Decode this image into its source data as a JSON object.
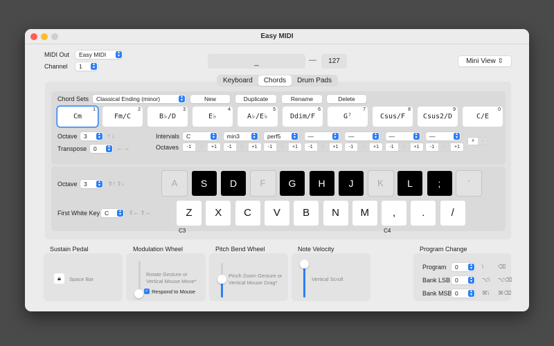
{
  "window": {
    "title": "Easy MIDI"
  },
  "header": {
    "midi_out_label": "MIDI Out",
    "midi_out_value": "Easy MIDI",
    "channel_label": "Channel",
    "channel_value": "1",
    "note_display": "_",
    "dash": "—",
    "velocity_display": "127",
    "mini_view_label": "Mini View",
    "mini_view_icon": "⇳"
  },
  "tabs": [
    {
      "label": "Keyboard",
      "selected": false
    },
    {
      "label": "Chords",
      "selected": true
    },
    {
      "label": "Drum Pads",
      "selected": false
    }
  ],
  "chords": {
    "chord_sets_label": "Chord Sets",
    "chord_set_value": "Classical Ending (minor)",
    "buttons": {
      "new": "New",
      "duplicate": "Duplicate",
      "rename": "Rename",
      "delete": "Delete"
    },
    "items": [
      {
        "name": "Cm",
        "key": "1",
        "selected": true
      },
      {
        "name": "Fm/C",
        "key": "2"
      },
      {
        "name": "B♭/D",
        "key": "3"
      },
      {
        "name": "E♭",
        "key": "4"
      },
      {
        "name": "A♭/E♭",
        "key": "5"
      },
      {
        "name": "Ddim/F",
        "key": "6"
      },
      {
        "name": "G⁷",
        "key": "7"
      },
      {
        "name": "Csus/F",
        "key": "8"
      },
      {
        "name": "Csus2/D",
        "key": "9"
      },
      {
        "name": "C/E",
        "key": "0"
      }
    ],
    "octave_label": "Octave",
    "octave_value": "3",
    "octave_arrows": "↑ ↓",
    "transpose_label": "Transpose",
    "transpose_value": "0",
    "transpose_arrows": "← →",
    "intervals_label": "Intervals",
    "octaves_label": "Octaves",
    "intervals": [
      "C",
      "min3",
      "perf5",
      "—",
      "—",
      "—",
      "—"
    ],
    "octave_buttons": {
      "minus": "-1",
      "zero": "0",
      "plus": "+1"
    },
    "sharp_flat": {
      "sharp": "#",
      "flat": "♭"
    }
  },
  "keyboard": {
    "octave_label": "Octave",
    "octave_value": "3",
    "octave_shortcuts": "⇧↑  ⇧↓",
    "first_white_key_label": "First White Key",
    "first_white_key_value": "C",
    "first_white_key_shortcuts": "⇧←  ⇧→",
    "black_row": [
      {
        "label": "A",
        "type": "dis"
      },
      {
        "label": "S",
        "type": "blk"
      },
      {
        "label": "D",
        "type": "blk"
      },
      {
        "label": "F",
        "type": "dis"
      },
      {
        "label": "G",
        "type": "blk"
      },
      {
        "label": "H",
        "type": "blk"
      },
      {
        "label": "J",
        "type": "blk"
      },
      {
        "label": "K",
        "type": "dis"
      },
      {
        "label": "L",
        "type": "blk"
      },
      {
        "label": ";",
        "type": "blk"
      },
      {
        "label": "'",
        "type": "dis"
      }
    ],
    "white_row": [
      {
        "label": "Z",
        "note": "C3"
      },
      {
        "label": "X",
        "note": ""
      },
      {
        "label": "C",
        "note": ""
      },
      {
        "label": "V",
        "note": ""
      },
      {
        "label": "B",
        "note": ""
      },
      {
        "label": "N",
        "note": ""
      },
      {
        "label": "M",
        "note": ""
      },
      {
        "label": ",",
        "note": "C4"
      },
      {
        "label": ".",
        "note": ""
      },
      {
        "label": "/",
        "note": ""
      }
    ]
  },
  "controls": {
    "sustain": {
      "title": "Sustain Pedal",
      "key_label": "Space Bar"
    },
    "modulation": {
      "title": "Modulation Wheel",
      "hint": "Rotate Gesture or Vertical Mouse Move*",
      "respond_label": "Respond to Mouse",
      "respond_checked": true,
      "value": 0
    },
    "pitch_bend": {
      "title": "Pitch Bend Wheel",
      "hint": "Pinch Zoom Gesture or Vertical Mouse Drag*",
      "value": 0.5
    },
    "velocity": {
      "title": "Note Velocity",
      "hint": "Vertical Scroll",
      "value": 1.0
    },
    "program_change": {
      "title": "Program Change",
      "rows": [
        {
          "label": "Program",
          "value": "0",
          "inc": "\\",
          "dec": "⌫"
        },
        {
          "label": "Bank LSB",
          "value": "0",
          "inc": "⌥\\",
          "dec": "⌥⌫"
        },
        {
          "label": "Bank MSB",
          "value": "0",
          "inc": "⌘\\",
          "dec": "⌘⌫"
        }
      ]
    }
  },
  "colors": {
    "accent": "#2d7ff5",
    "close": "#fe5f57",
    "minimize": "#febc2e",
    "zoom_disabled": "#cfcfcf"
  }
}
